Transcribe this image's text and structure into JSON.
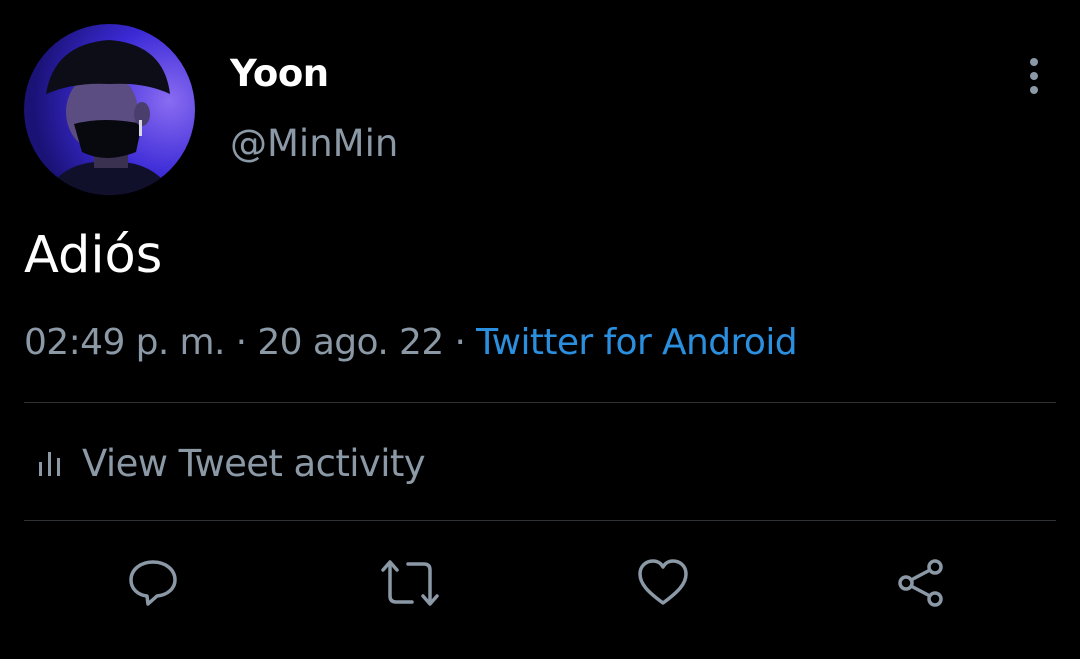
{
  "tweet": {
    "author": {
      "display_name": "Yoon",
      "handle": "@MinMin"
    },
    "text": "Adiós",
    "meta": {
      "time": "02:49 p. m.",
      "separator": " · ",
      "date": "20 ago. 22",
      "source": "Twitter for Android"
    },
    "activity_label": "View Tweet activity"
  },
  "icons": {
    "more": "more-vertical-icon",
    "activity": "bar-chart-icon",
    "reply": "comment-icon",
    "retweet": "retweet-icon",
    "like": "heart-icon",
    "share": "share-icon"
  },
  "colors": {
    "background": "#000000",
    "primary_text": "#ffffff",
    "secondary_text": "#8b98a5",
    "link": "#2b8fe0",
    "divider": "#2f3336"
  }
}
